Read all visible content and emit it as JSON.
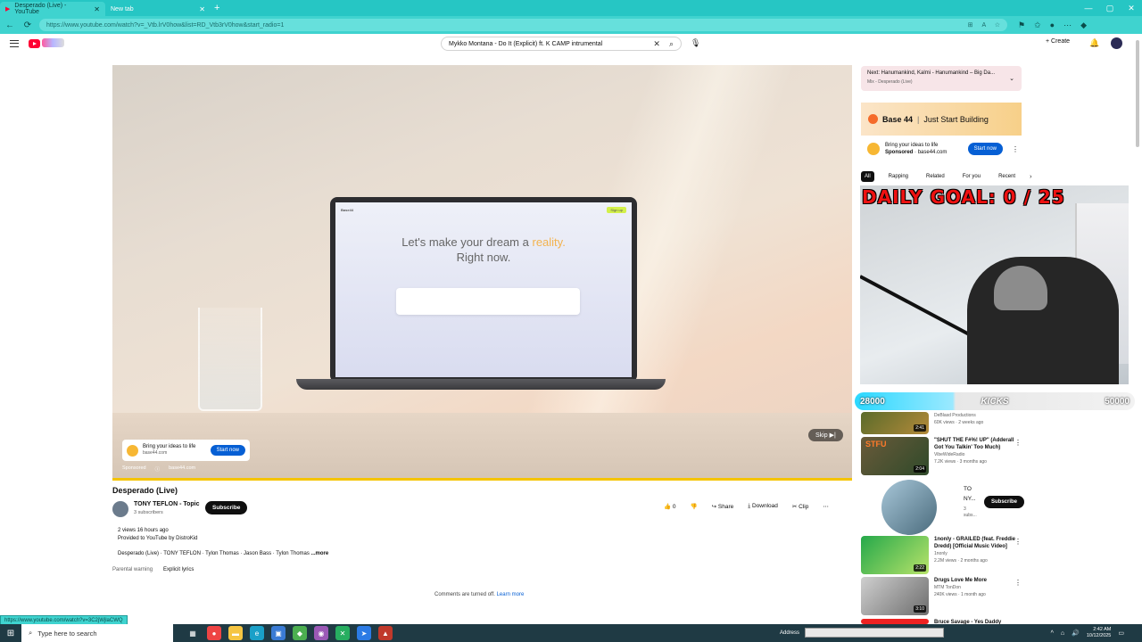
{
  "browser": {
    "tabs": [
      {
        "label": "Desperado (Live) - YouTube",
        "active": true
      },
      {
        "label": "New tab",
        "active": false
      }
    ],
    "url": "https://www.youtube.com/watch?v=_Vtb.lrV0how&list=RD_Vtb3rV0how&start_radio=1"
  },
  "header": {
    "search_query": "Mykko Montana - Do It (Explicit) ft. K CAMP intrumental",
    "create_label": "Create"
  },
  "player": {
    "laptop_brand": "Base44",
    "laptop_headline_1": "Let's make your dream a",
    "laptop_headline_accent": "reality.",
    "laptop_headline_2": "Right now.",
    "laptop_signup": "Sign up",
    "ad_title": "Bring your ideas to life",
    "ad_domain": "base44.com",
    "ad_button": "Start now",
    "sponsored": "Sponsored",
    "ad_meta_domain": "base44.com",
    "skip_label": "Skip"
  },
  "video": {
    "title": "Desperado (Live)",
    "channel": "TONY TEFLON - Topic",
    "subscribers": "3 subscribers",
    "subscribe_label": "Subscribe",
    "likes": "0",
    "share_label": "Share",
    "download_label": "Download",
    "clip_label": "Clip",
    "views_time": "2 views  16 hours ago",
    "provided": "Provided to YouTube by DistroKid",
    "credits": "Desperado (Live) · TONY TEFLON · Tylon Thomas · Jason Bass · Tylon Thomas",
    "more_label": "...more",
    "parental": "Parental warning",
    "explicit": "Explicit lyrics",
    "comments_off": "Comments are turned off.",
    "learn_more": "Learn more"
  },
  "sidebar": {
    "next_title": "Next: Hanumankind, Kalmi - Hanumankind – Big Da...",
    "next_sub": "Mix - Desperado (Live)",
    "ad_brand": "Base 44",
    "ad_tagline": "Just Start Building",
    "ad_row_title": "Bring your ideas to life",
    "ad_row_sponsored": "Sponsored",
    "ad_row_domain": "base44.com",
    "ad_row_button": "Start now",
    "chips": [
      "All",
      "Rapping",
      "Related",
      "For you",
      "Recent"
    ],
    "overlay_goal": "DAILY GOAL: 0 / 25",
    "kicks_left": "28000",
    "kicks_mid": "KICKS",
    "kicks_right": "50000",
    "recs": [
      {
        "title": "",
        "channel": "DeBlasd Productions",
        "meta": "60K views · 2 weeks ago",
        "duration": "2:41"
      },
      {
        "title": "\"SHUT THE F#%! UP\" (Adderall Got You Talkin' Too Much)",
        "channel": "VibeWideRadio",
        "meta": "7.2K views · 3 months ago",
        "duration": "2:04",
        "thumb_text": "STFU"
      },
      {
        "title": "1nonly - GRAILED (feat. Freddie Dredd) [Official Music Video]",
        "channel": "1nonly",
        "meta": "2.2M views · 2 months ago",
        "duration": "2:22"
      },
      {
        "title": "Drugs Love Me More",
        "channel": "MTM TonDon",
        "meta": "240K views · 1 month ago",
        "duration": "3:10"
      },
      {
        "title": "Bruce Savage - Yes Daddy",
        "channel": "",
        "meta": "",
        "duration": ""
      }
    ],
    "channel_card": {
      "name_1": "TO",
      "name_2": "NY...",
      "subs_1": "3",
      "subs_2": "subs...",
      "button": "Subscribe"
    }
  },
  "status_url": "https://www.youtube.com/watch?v=3C2jWjlaCWQ",
  "taskbar": {
    "search_placeholder": "Type here to search",
    "address_label": "Address",
    "time": "2:42 AM",
    "date": "10/12/2025"
  }
}
